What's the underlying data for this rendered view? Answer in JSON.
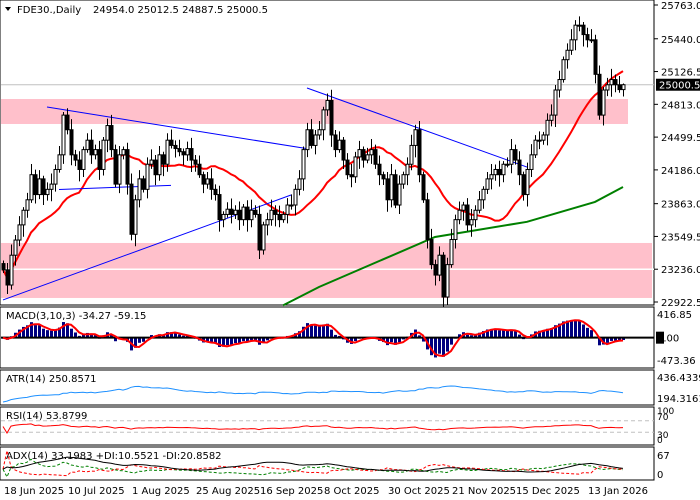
{
  "header": {
    "symbol": "FDE30.,Daily",
    "ohlc": "24954.0 25012.5 24887.5 25000.5"
  },
  "colors": {
    "zone": "#ffc0cb",
    "ma_fast": "#ff0000",
    "ma_slow": "#008000",
    "trendline": "#0000ff",
    "macd_hist": "#000080",
    "macd_signal": "#ff0000",
    "atr": "#1e90ff",
    "rsi": "#ff0000",
    "adx": "#000000",
    "plus_di": "#008000",
    "minus_di": "#ff0000"
  },
  "chart_data": {
    "type": "candlestick",
    "title": "FDE30.,Daily",
    "last_bar": {
      "open": 24954.0,
      "high": 25012.5,
      "low": 24887.5,
      "close": 25000.5
    },
    "closes": [
      23230,
      23085,
      23370,
      23515,
      23660,
      23800,
      23900,
      24140,
      23950,
      24100,
      23950,
      24000,
      24050,
      24190,
      24330,
      24710,
      24570,
      24330,
      24280,
      24190,
      24380,
      24470,
      24330,
      24380,
      24190,
      24470,
      24610,
      24380,
      24050,
      24330,
      24380,
      24050,
      23570,
      23900,
      24100,
      24000,
      24240,
      24280,
      24140,
      24330,
      24240,
      24470,
      24420,
      24390,
      24360,
      24330,
      24390,
      24280,
      24240,
      24140,
      24050,
      24100,
      24000,
      23950,
      23710,
      23760,
      23810,
      23760,
      23800,
      23710,
      23830,
      23710,
      23800,
      23760,
      23420,
      23660,
      23710,
      23800,
      23760,
      23710,
      23760,
      23850,
      23850,
      24000,
      24100,
      24380,
      24570,
      24420,
      24520,
      24570,
      24760,
      24850,
      24520,
      24380,
      24470,
      24280,
      24140,
      24120,
      24310,
      24380,
      24280,
      24330,
      24380,
      24240,
      24140,
      24100,
      23900,
      24140,
      23850,
      24050,
      24140,
      24240,
      24420,
      24570,
      24140,
      23900,
      23520,
      23280,
      23180,
      23370,
      22970,
      23280,
      23520,
      23710,
      23800,
      23850,
      23660,
      23710,
      23800,
      23900,
      24000,
      24100,
      24140,
      24190,
      24140,
      24240,
      24240,
      24380,
      24280,
      24140,
      23950,
      24190,
      24330,
      24470,
      24470,
      24520,
      24660,
      24710,
      24950,
      25050,
      25240,
      25330,
      25430,
      25570,
      25570,
      25480,
      25430,
      25430,
      25100,
      24710,
      24950,
      25000,
      25050,
      25000,
      24954,
      25000.5
    ],
    "price_axis": {
      "ticks": [
        "25763.0",
        "25440.0",
        "25126.5",
        "24813.0",
        "24499.5",
        "24186.0",
        "23863.0",
        "23549.5",
        "23236.0",
        "22922.5"
      ],
      "range": [
        22922.5,
        25763.0
      ],
      "current_price": "25000.5"
    },
    "x_ticks": [
      {
        "label": "18 Jun 2025",
        "index": 0
      },
      {
        "label": "10 Jul 2025",
        "index": 16
      },
      {
        "label": "1 Aug 2025",
        "index": 32
      },
      {
        "label": "25 Aug 2025",
        "index": 48
      },
      {
        "label": "16 Sep 2025",
        "index": 64
      },
      {
        "label": "8 Oct 2025",
        "index": 80
      },
      {
        "label": "30 Oct 2025",
        "index": 96
      },
      {
        "label": "21 Nov 2025",
        "index": 112
      },
      {
        "label": "15 Dec 2025",
        "index": 128
      },
      {
        "label": "13 Jan 2026",
        "index": 146
      }
    ],
    "zones": [
      {
        "from": 24625,
        "to": 24864,
        "end_index": 156
      },
      {
        "from": 22961,
        "to": 23487,
        "end_index": 162
      }
    ],
    "levels": [
      23236.0
    ],
    "trendlines": [
      {
        "from": [
          11,
          24787
        ],
        "to": [
          76,
          24389
        ]
      },
      {
        "from": [
          14,
          23999
        ],
        "to": [
          42,
          24038
        ]
      },
      {
        "from": [
          0,
          22942
        ],
        "to": [
          72,
          23946
        ]
      },
      {
        "from": [
          76,
          24969
        ],
        "to": [
          131,
          24213
        ]
      }
    ],
    "ma_fast_period": 20,
    "ma_slow_points": [
      [
        70,
        22890
      ],
      [
        79,
        23066
      ],
      [
        108,
        23544
      ],
      [
        131,
        23690
      ],
      [
        148,
        23880
      ],
      [
        155,
        24022
      ]
    ],
    "indicators": {
      "macd": {
        "label": "MACD(3,10,3) -34.27 -59.15",
        "ticks": [
          "416.85",
          "0.00",
          "-473.36"
        ],
        "range": [
          -473.36,
          416.85
        ]
      },
      "atr": {
        "label": "ATR(14) 250.8571",
        "ticks": [
          "436.4339",
          "194.3161"
        ]
      },
      "rsi": {
        "label": "RSI(14) 53.8799",
        "ticks": [
          "100",
          "70",
          "30",
          "0"
        ],
        "levels": [
          70,
          30
        ]
      },
      "adx": {
        "label": "ADX(14) 33.1983 +DI:10.5521 -DI:20.8582",
        "ticks": [
          "67",
          "0"
        ]
      }
    }
  }
}
